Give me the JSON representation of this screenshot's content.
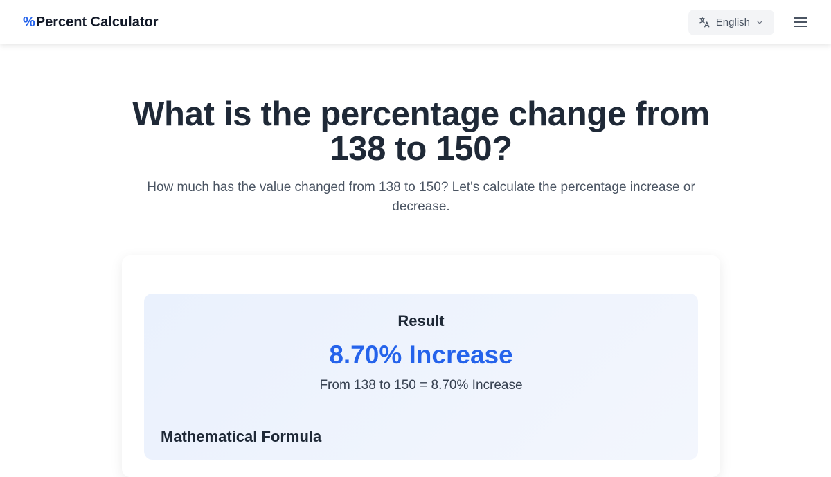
{
  "header": {
    "brand_symbol": "%",
    "brand_name": "Percent Calculator",
    "language_label": "English"
  },
  "icons": {
    "language": "translate-icon",
    "dropdown": "chevron-down-icon",
    "menu": "hamburger-menu-icon"
  },
  "main": {
    "title": "What is the percentage change from 138 to 150?",
    "subtitle": "How much has the value changed from 138 to 150? Let's calculate the percentage increase or decrease."
  },
  "result": {
    "heading": "Result",
    "value": "8.70% Increase",
    "description": "From 138 to 150 = 8.70% Increase"
  },
  "formula": {
    "heading": "Mathematical Formula"
  },
  "colors": {
    "accent": "#2563eb",
    "text_dark": "#1f2937",
    "text_muted": "#4b5563",
    "result_bg": "#eaf1fd"
  }
}
